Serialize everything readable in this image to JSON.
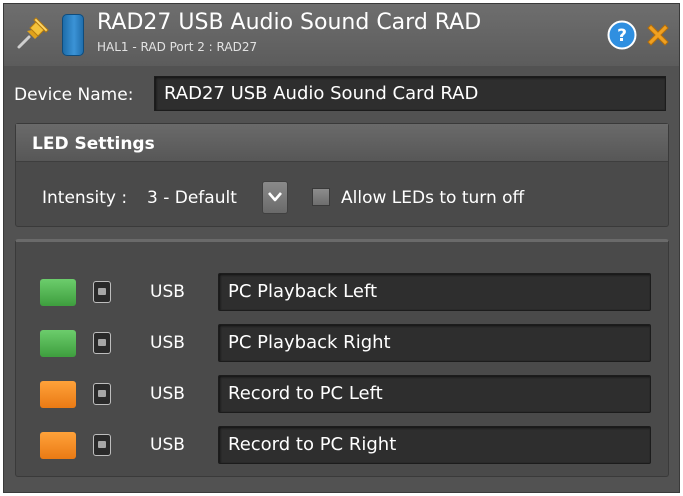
{
  "window": {
    "title": "RAD27 USB Audio Sound Card RAD",
    "subtitle": "HAL1 - RAD Port 2  :  RAD27",
    "icons": [
      "pin-icon",
      "device-icon",
      "help-icon",
      "close-icon"
    ]
  },
  "device_name": {
    "label": "Device Name:",
    "value": "RAD27 USB Audio Sound Card RAD"
  },
  "led_settings": {
    "title": "LED Settings",
    "intensity_label": "Intensity :",
    "intensity_value": "3 - Default",
    "allow_leds_off_label": "Allow LEDs to turn off",
    "allow_leds_off_checked": false
  },
  "channels": [
    {
      "led_color": "#4caf50",
      "interface": "USB",
      "name": "PC Playback Left"
    },
    {
      "led_color": "#4caf50",
      "interface": "USB",
      "name": "PC Playback Right"
    },
    {
      "led_color": "#f5891f",
      "interface": "USB",
      "name": "Record to PC Left"
    },
    {
      "led_color": "#f5891f",
      "interface": "USB",
      "name": "Record to PC Right"
    }
  ],
  "colors": {
    "window_bg": "#525252",
    "field_bg": "#2e2e2e",
    "help_blue": "#2f8fe0",
    "close_orange": "#f0a020"
  }
}
